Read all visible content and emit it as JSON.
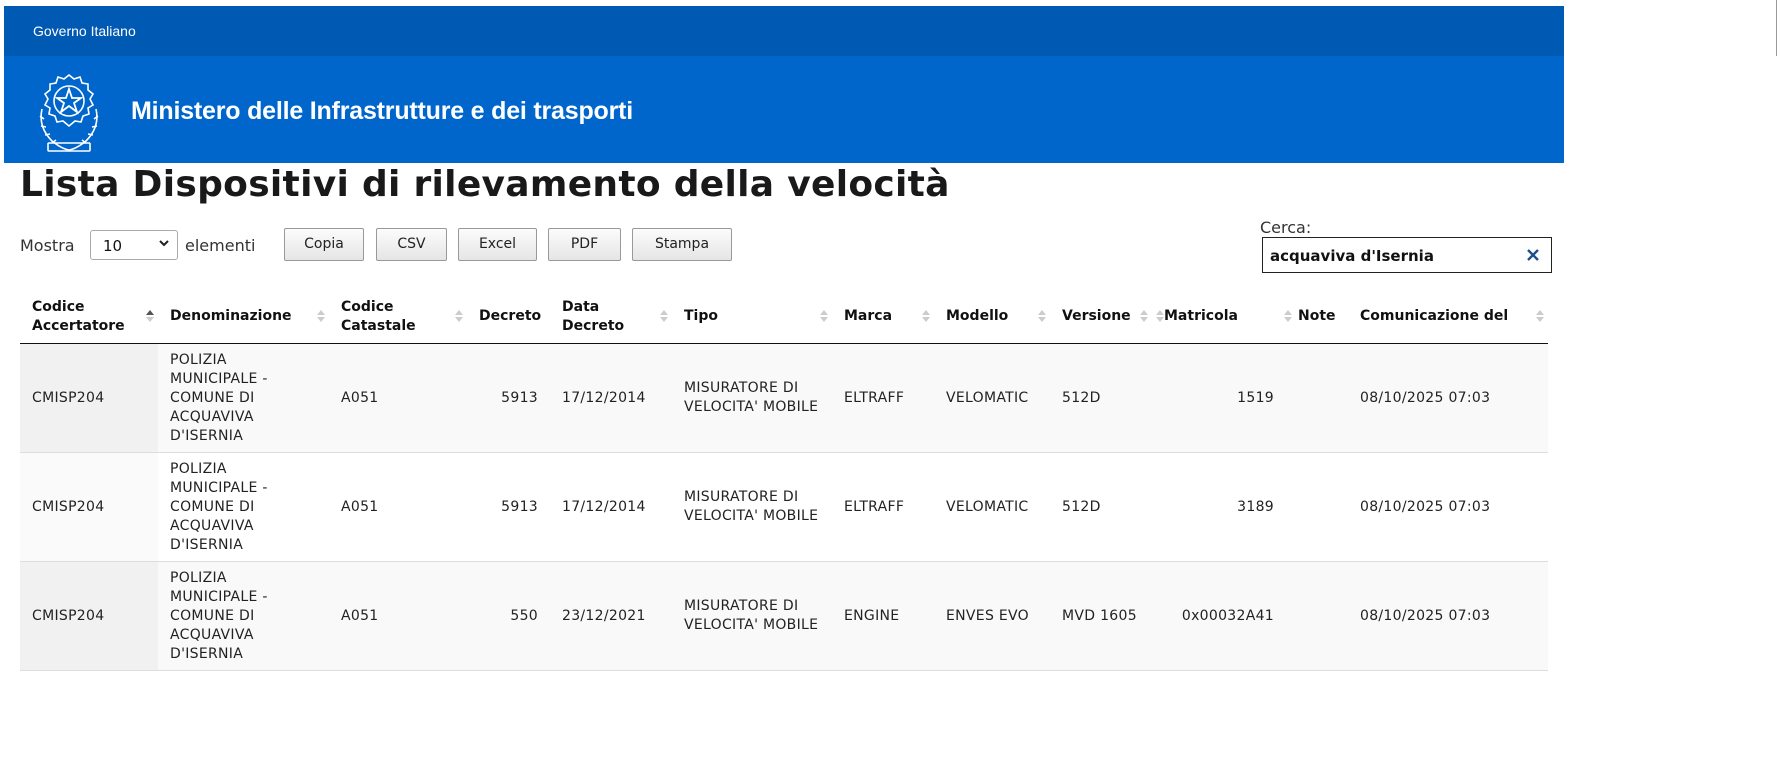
{
  "header": {
    "gov_label": "Governo Italiano",
    "ministry_title": "Ministero delle Infrastrutture e dei trasporti"
  },
  "page": {
    "title": "Lista Dispositivi di rilevamento della velocità"
  },
  "controls": {
    "show_label": "Mostra",
    "page_length": "10",
    "entries_label": "elementi",
    "buttons": [
      "Copia",
      "CSV",
      "Excel",
      "PDF",
      "Stampa"
    ],
    "search_label": "Cerca:",
    "search_value": "acquaviva d'Isernia"
  },
  "table": {
    "headers": [
      "Codice Accertatore",
      "Denominazione",
      "Codice Catastale",
      "Decreto",
      "Data Decreto",
      "Tipo",
      "Marca",
      "Modello",
      "Versione",
      "Matricola",
      "Note",
      "Comunicazione del"
    ],
    "rows": [
      [
        "CMISP204",
        "POLIZIA MUNICIPALE - COMUNE DI ACQUAVIVA D'ISERNIA",
        "A051",
        "5913",
        "17/12/2014",
        "MISURATORE DI VELOCITA' MOBILE",
        "ELTRAFF",
        "VELOMATIC",
        "512D",
        "1519",
        "",
        "08/10/2025 07:03"
      ],
      [
        "CMISP204",
        "POLIZIA MUNICIPALE - COMUNE DI ACQUAVIVA D'ISERNIA",
        "A051",
        "5913",
        "17/12/2014",
        "MISURATORE DI VELOCITA' MOBILE",
        "ELTRAFF",
        "VELOMATIC",
        "512D",
        "3189",
        "",
        "08/10/2025 07:03"
      ],
      [
        "CMISP204",
        "POLIZIA MUNICIPALE - COMUNE DI ACQUAVIVA D'ISERNIA",
        "A051",
        "550",
        "23/12/2021",
        "MISURATORE DI VELOCITA' MOBILE",
        "ENGINE",
        "ENVES EVO",
        "MVD 1605",
        "0x00032A41",
        "",
        "08/10/2025 07:03"
      ]
    ]
  },
  "colors": {
    "gov_bar": "#0059b3",
    "ministry_bar": "#0066cc"
  }
}
